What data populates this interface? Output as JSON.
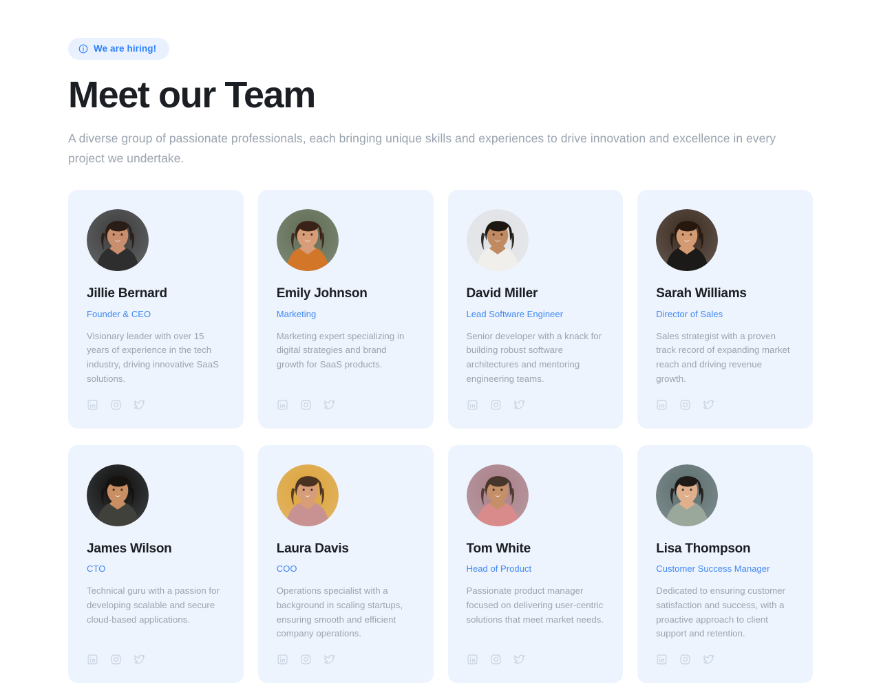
{
  "badge": {
    "icon": "info-circle-icon",
    "label": "We are hiring!",
    "bg": "#e9f1fe",
    "color": "#2b7fff"
  },
  "header": {
    "title": "Meet our Team",
    "subtitle": "A diverse group of passionate professionals, each bringing unique skills and experiences to drive innovation and excellence in every project we undertake."
  },
  "theme": {
    "card_bg": "#eef4fd",
    "role_color": "#3f87f5",
    "body_color": "#9aa3af",
    "name_color": "#1b1e23",
    "social_color": "#c7d2e0"
  },
  "socials": [
    {
      "name": "linkedin-icon",
      "label": "LinkedIn"
    },
    {
      "name": "instagram-icon",
      "label": "Instagram"
    },
    {
      "name": "twitter-icon",
      "label": "Twitter"
    }
  ],
  "members": [
    {
      "name": "Jillie Bernard",
      "role": "Founder & CEO",
      "bio": "Visionary leader with over 15 years of experience in the tech industry, driving innovative SaaS solutions.",
      "avatar": {
        "bg": "#3b3b3b",
        "skin": "#c98e6d",
        "hair": "#2a1c16",
        "top": "#2e2e2e"
      }
    },
    {
      "name": "Emily Johnson",
      "role": "Marketing",
      "bio": "Marketing expert specializing in digital strategies and brand growth for SaaS products.",
      "avatar": {
        "bg": "#5f6b52",
        "skin": "#d79d79",
        "hair": "#3a2218",
        "top": "#d2762a"
      }
    },
    {
      "name": "David Miller",
      "role": "Lead Software Engineer",
      "bio": "Senior developer with a knack for building robust software architectures and mentoring engineering teams.",
      "avatar": {
        "bg": "#e2e3e5",
        "skin": "#c08a62",
        "hair": "#1d1713",
        "top": "#f1efec"
      }
    },
    {
      "name": "Sarah Williams",
      "role": "Director of Sales",
      "bio": "Sales strategist with a proven track record of expanding market reach and driving revenue growth.",
      "avatar": {
        "bg": "#3b2a1e",
        "skin": "#d49a72",
        "hair": "#27180f",
        "top": "#1c1a19"
      }
    },
    {
      "name": "James Wilson",
      "role": "CTO",
      "bio": "Technical guru with a passion for developing scalable and secure cloud-based applications.",
      "avatar": {
        "bg": "#0c0c0c",
        "skin": "#c98f63",
        "hair": "#161210",
        "top": "#40413a"
      }
    },
    {
      "name": "Laura Davis",
      "role": "COO",
      "bio": "Operations specialist with a background in scaling startups, ensuring smooth and efficient company operations.",
      "avatar": {
        "bg": "#dda33a",
        "skin": "#d79d79",
        "hair": "#4a3222",
        "top": "#c99292"
      }
    },
    {
      "name": "Tom White",
      "role": "Head of Product",
      "bio": "Passionate product manager focused on delivering user-centric solutions that meet market needs.",
      "avatar": {
        "bg": "#a97f87",
        "skin": "#c58f68",
        "hair": "#46362c",
        "top": "#d98b8b"
      }
    },
    {
      "name": "Lisa Thompson",
      "role": "Customer Success Manager",
      "bio": "Dedicated to ensuring customer satisfaction and success, with a proactive approach to client support and retention.",
      "avatar": {
        "bg": "#5d6e6e",
        "skin": "#e0b08c",
        "hair": "#1f1a18",
        "top": "#9aa89c"
      }
    }
  ]
}
